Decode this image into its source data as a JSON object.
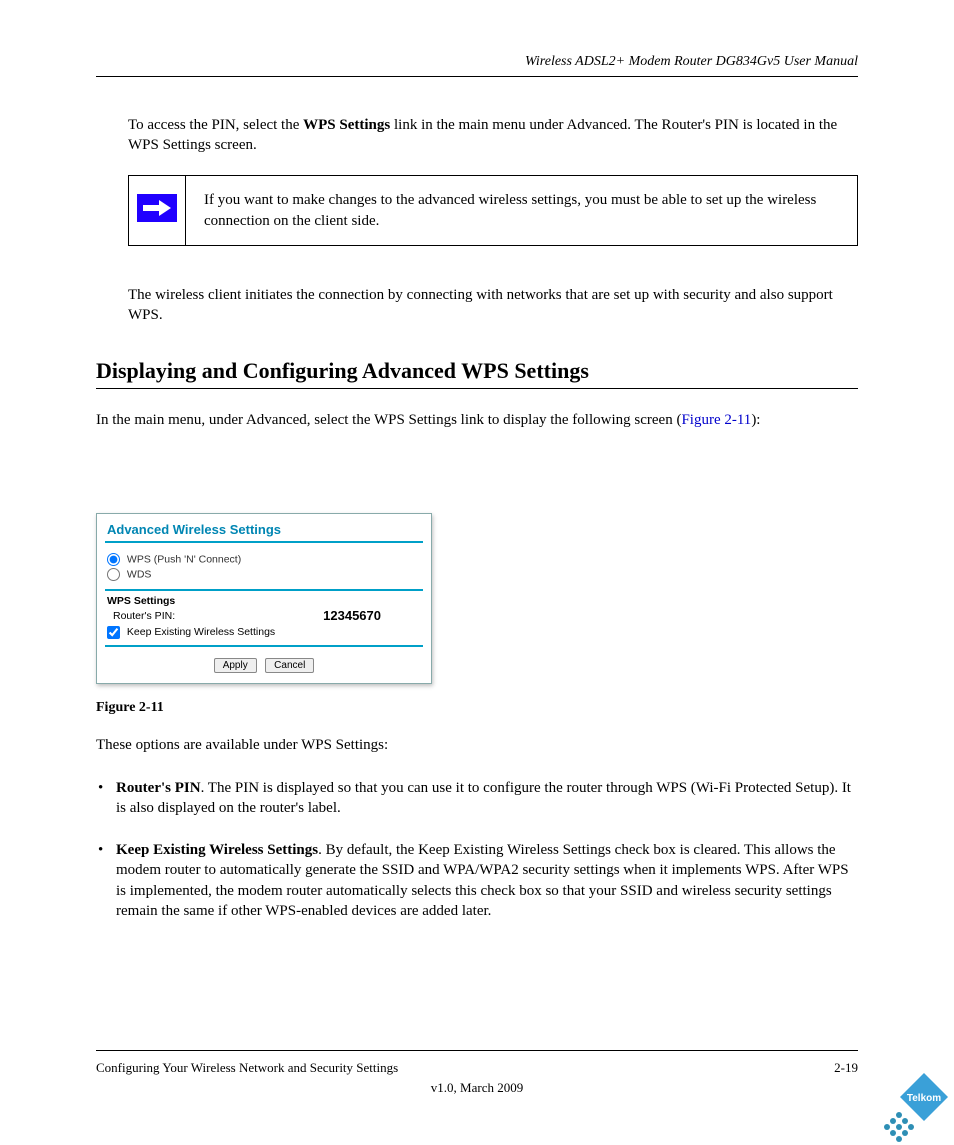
{
  "header": {
    "manual_title": "Wireless ADSL2+ Modem Router DG834Gv5 User Manual"
  },
  "paragraphs": {
    "p1_prefix": "To access the PIN, select the ",
    "p1_strong": "WPS Settings",
    "p1_suffix": " link in the main menu under Advanced. The Router's PIN is located in the WPS Settings screen.",
    "note": "If you want to make changes to the advanced wireless settings, you must be able to set up the wireless connection on the client side.",
    "p2": "The wireless client initiates the connection by connecting with networks that are set up with security and also support WPS.",
    "heading": "Displaying and Configuring Advanced WPS Settings",
    "p3_prefix": "In the main menu, under Advanced, select the WPS Settings link to display the following screen ",
    "p3_link_text": "Figure 2-11",
    "p3_suffix": "):",
    "figure_caption": "Figure 2-11",
    "p4": "These options are available under WPS Settings:",
    "bullet1_strong": "Router's PIN",
    "bullet1_text": ". The PIN is displayed so that you can use it to configure the router through WPS (Wi-Fi Protected Setup). It is also displayed on the router's label.",
    "bullet2_strong": "Keep Existing Wireless Settings",
    "bullet2_text_part1": ". By default, the Keep Existing Wireless Settings check box is cleared. This allows the modem router to automatically generate the SSID and WPA/WPA2 security settings when it implements WPS. After WPS is implemented, the modem router automatically selects this check box so that your SSID and wireless security settings remain the same if other WPS-enabled devices are added later."
  },
  "router_ui": {
    "title": "Advanced Wireless Settings",
    "radio_wps": "WPS (Push 'N' Connect)",
    "radio_wds": "WDS",
    "section_label": "WPS Settings",
    "pin_label": "Router's PIN:",
    "pin_value": "12345670",
    "keep_label": "Keep Existing Wireless Settings",
    "apply": "Apply",
    "cancel": "Cancel"
  },
  "footer": {
    "left": "Configuring Your Wireless Network and Security Settings",
    "right": "2-19",
    "version": "v1.0, March 2009"
  },
  "logo": {
    "text": "Telkom"
  }
}
